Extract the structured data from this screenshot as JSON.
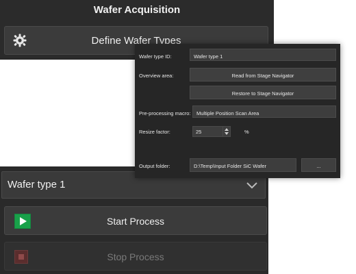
{
  "header": {
    "title": "Wafer Acquisition",
    "define_button": "Define Wafer Types"
  },
  "dialog": {
    "wafer_type_id_label": "Wafer type ID:",
    "wafer_type_id_value": "Wafer type 1",
    "overview_area_label": "Overview area:",
    "read_button": "Read from Stage Navigator",
    "restore_button": "Restore to Stage Navigator",
    "preprocessing_label": "Pre-processing macro:",
    "preprocessing_value": "Multiple Position Scan Area",
    "resize_label": "Resize factor:",
    "resize_value": "25",
    "resize_unit": "%",
    "output_label": "Output folder:",
    "output_value": "D:\\Temp\\Input Folder SiC Wafer",
    "browse_button": "..."
  },
  "process": {
    "wafer_selected": "Wafer type 1",
    "start_button": "Start Process",
    "stop_button": "Stop Process"
  },
  "icons": {
    "define": "gear-icon",
    "dropdown": "chevron-down-icon",
    "start": "play-icon",
    "stop": "stop-icon"
  },
  "colors": {
    "start_icon": "#19a14a",
    "stop_icon": "#5a2d2d",
    "panel": "#2b2b2b"
  }
}
